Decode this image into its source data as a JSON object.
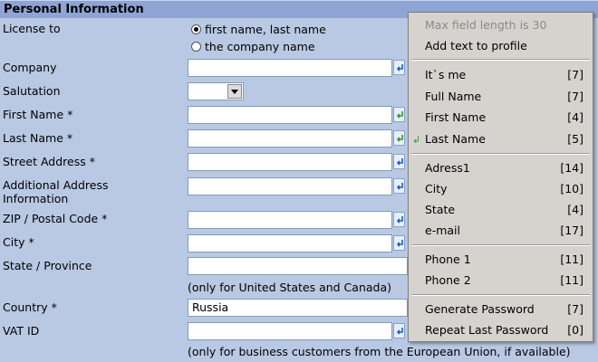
{
  "section_title": "Personal Information",
  "license": {
    "label": "License to",
    "options": [
      {
        "label": "first name, last name",
        "selected": true
      },
      {
        "label": "the company name",
        "selected": false
      }
    ]
  },
  "fields": {
    "company": {
      "label": "Company",
      "value": ""
    },
    "salutation": {
      "label": "Salutation",
      "value": ""
    },
    "first_name": {
      "label": "First Name *",
      "value": ""
    },
    "last_name": {
      "label": "Last Name *",
      "value": ""
    },
    "street": {
      "label": "Street Address *",
      "value": ""
    },
    "additional_1": {
      "label": "Additional Address",
      "value": ""
    },
    "additional_2": {
      "label": "Information",
      "value": ""
    },
    "zip": {
      "label": "ZIP / Postal Code *",
      "value": ""
    },
    "city": {
      "label": "City *",
      "value": ""
    },
    "state": {
      "label": "State / Province",
      "value": ""
    },
    "country": {
      "label": "Country *",
      "value": "Russia"
    },
    "vat": {
      "label": "VAT ID",
      "value": ""
    }
  },
  "notes": {
    "state_note": "(only for United States and Canada)",
    "vat_note": "(only for business customers from the European Union, if available)"
  },
  "context_menu": {
    "header": "Max field length is 30",
    "add_text": "Add text to profile",
    "items": [
      {
        "label": "It`s me",
        "count": "[7]"
      },
      {
        "label": "Full Name",
        "count": "[7]"
      },
      {
        "label": "First Name",
        "count": "[4]"
      },
      {
        "label": "Last Name",
        "count": "[5]"
      },
      {
        "label": "Adress1",
        "count": "[14]"
      },
      {
        "label": "City",
        "count": "[10]"
      },
      {
        "label": "State",
        "count": "[4]"
      },
      {
        "label": "e-mail",
        "count": "[17]"
      },
      {
        "label": "Phone 1",
        "count": "[11]"
      },
      {
        "label": "Phone 2",
        "count": "[11]"
      },
      {
        "label": "Generate Password",
        "count": "[7]"
      },
      {
        "label": "Repeat Last Password",
        "count": "[0]"
      }
    ]
  },
  "colors": {
    "background": "#b9c8e3",
    "header": "#8ea5d4",
    "menu": "#d6d3ce"
  }
}
